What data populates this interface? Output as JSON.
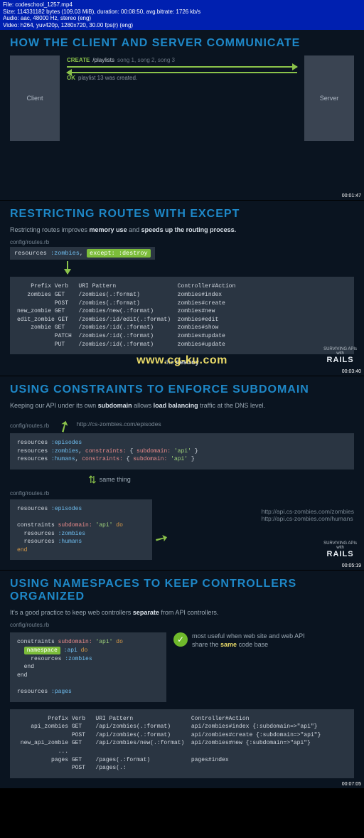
{
  "media": {
    "file": "File: codeschool_1257.mp4",
    "size": "Size: 114331182 bytes (109.03 MiB), duration: 00:08:50, avg.bitrate: 1726 kb/s",
    "audio": "Audio: aac, 48000 Hz, stereo (eng)",
    "video": "Video: h264, yuv420p, 1280x720, 30.00 fps(r) (eng)"
  },
  "slide1": {
    "title": "HOW THE CLIENT AND SERVER COMMUNICATE",
    "client": "Client",
    "server": "Server",
    "create": "CREATE",
    "create_path": "/playlists",
    "create_body": "song 1, song 2, song 3",
    "ok": "OK",
    "ok_msg": "playlist 13 was created.",
    "timestamp": "00:01:47"
  },
  "slide2": {
    "title": "RESTRICTING ROUTES WITH EXCEPT",
    "sub_a": "Restricting routes improves ",
    "sub_b": "memory use",
    "sub_c": " and ",
    "sub_d": "speeds up the routing process.",
    "file": "config/routes.rb",
    "code_inline_a": "resources ",
    "code_inline_b": ":zombies",
    "code_inline_c": ", ",
    "code_inline_d": "except: :destroy",
    "routes": "    Prefix Verb   URI Pattern                  Controller#Action\n   zombies GET    /zombies(.:format)           zombies#index\n           POST   /zombies(.:format)           zombies#create\nnew_zombie GET    /zombies/new(.:format)       zombies#new\nedit_zombie GET   /zombies/:id/edit(.:format)  zombies#edit\n    zombie GET    /zombies/:id(.:format)       zombies#show\n           PATCH  /zombies/:id(.:format)       zombies#update\n           PUT    /zombies/:id(.:format)       zombies#update",
    "caption_a": "the ",
    "caption_b": "destroy",
    "watermark": "www.cg-ku.com",
    "brand_small": "SURVIVING APIs\nwith",
    "brand_big": "RAILS",
    "timestamp": "00:03:40"
  },
  "slide3": {
    "title": "USING CONSTRAINTS TO ENFORCE SUBDOMAIN",
    "sub_a": "Keeping our API under its own ",
    "sub_b": "subdomain",
    "sub_c": " allows ",
    "sub_d": "load balancing",
    "sub_e": " traffic at the DNS level.",
    "file": "config/routes.rb",
    "url_top": "http://cs-zombies.com/episodes",
    "same": "same thing",
    "url_r1": "http://api.cs-zombies.com/zombies",
    "url_r2": "http://api.cs-zombies.com/humans",
    "brand_small": "SURVIVING APIs\nwith",
    "brand_big": "RAILS",
    "timestamp": "00:05:19"
  },
  "slide4": {
    "title": "USING NAMESPACES TO KEEP CONTROLLERS ORGANIZED",
    "sub_a": "It's a good practice to keep web controllers ",
    "sub_b": "separate",
    "sub_c": " from API controllers.",
    "file": "config/routes.rb",
    "note_a": "most useful when web site and web API share the ",
    "note_b": "same",
    "note_c": " code base",
    "routes": "         Prefix Verb   URI Pattern                 Controller#Action\n    api_zombies GET    /api/zombies(.:format)      api/zombies#index {:subdomain=>\"api\"}\n                POST   /api/zombies(.:format)      api/zombies#create {:subdomain=>\"api\"}\n new_api_zombie GET    /api/zombies/new(.:format)  api/zombies#new {:subdomain=>\"api\"}\n            ...\n          pages GET    /pages(.:format)            pages#index\n                POST   /pages(.:",
    "timestamp": "00:07:05"
  }
}
